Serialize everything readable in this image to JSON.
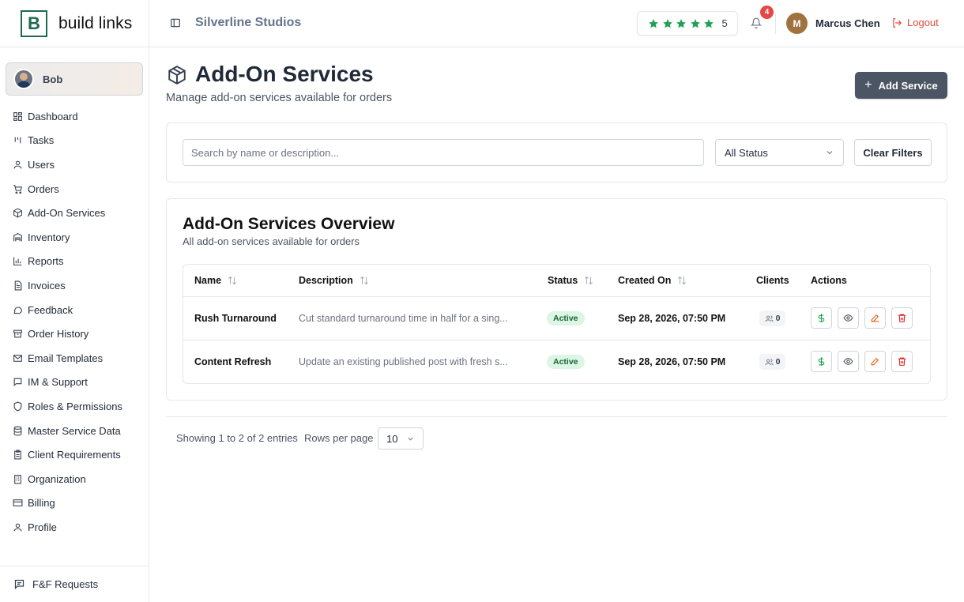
{
  "brand": {
    "logo_letter": "B",
    "name": "build links",
    "accent": "#1f6b4f"
  },
  "sidebar": {
    "user_name": "Bob",
    "items": [
      {
        "label": "Dashboard",
        "icon": "dashboard-icon"
      },
      {
        "label": "Tasks",
        "icon": "kanban-icon"
      },
      {
        "label": "Users",
        "icon": "user-icon"
      },
      {
        "label": "Orders",
        "icon": "cart-icon"
      },
      {
        "label": "Add-On Services",
        "icon": "package-icon"
      },
      {
        "label": "Inventory",
        "icon": "warehouse-icon"
      },
      {
        "label": "Reports",
        "icon": "bar-chart-icon"
      },
      {
        "label": "Invoices",
        "icon": "file-text-icon"
      },
      {
        "label": "Feedback",
        "icon": "message-circle-icon"
      },
      {
        "label": "Order History",
        "icon": "archive-icon"
      },
      {
        "label": "Email Templates",
        "icon": "mail-icon"
      },
      {
        "label": "IM & Support",
        "icon": "message-square-icon"
      },
      {
        "label": "Roles & Permissions",
        "icon": "shield-icon"
      },
      {
        "label": "Master Service Data",
        "icon": "database-icon"
      },
      {
        "label": "Client Requirements",
        "icon": "clipboard-icon"
      },
      {
        "label": "Organization",
        "icon": "building-icon"
      },
      {
        "label": "Billing",
        "icon": "credit-card-icon"
      },
      {
        "label": "Profile",
        "icon": "user-icon"
      }
    ],
    "footer_label": "F&F Requests"
  },
  "header": {
    "org_name": "Silverline Studios",
    "rating_value": "5",
    "rating_stars": 5,
    "notification_count": "4",
    "user_initial": "M",
    "user_name": "Marcus Chen",
    "logout_label": "Logout",
    "colors": {
      "star": "#22a05a",
      "badge": "#e54646",
      "logout": "#e04a3a"
    }
  },
  "page": {
    "title": "Add-On Services",
    "subtitle": "Manage add-on services available for orders",
    "add_button_label": "Add Service"
  },
  "filters": {
    "search_placeholder": "Search by name or description...",
    "search_value": "",
    "status_selected": "All Status",
    "clear_label": "Clear Filters"
  },
  "overview": {
    "title": "Add-On Services Overview",
    "subtitle": "All add-on services available for orders",
    "columns": [
      "Name",
      "Description",
      "Status",
      "Created On",
      "Clients",
      "Actions"
    ],
    "rows": [
      {
        "name": "Rush Turnaround",
        "description": "Cut standard turnaround time in half for a sing...",
        "status": "Active",
        "created_on": "Sep 28, 2026, 07:50 PM",
        "clients": "0"
      },
      {
        "name": "Content Refresh",
        "description": "Update an existing published post with fresh s...",
        "status": "Active",
        "created_on": "Sep 28, 2026, 07:50 PM",
        "clients": "0"
      }
    ]
  },
  "pagination": {
    "showing_text": "Showing 1 to 2 of 2 entries",
    "rows_label": "Rows per page",
    "rows_value": "10"
  }
}
